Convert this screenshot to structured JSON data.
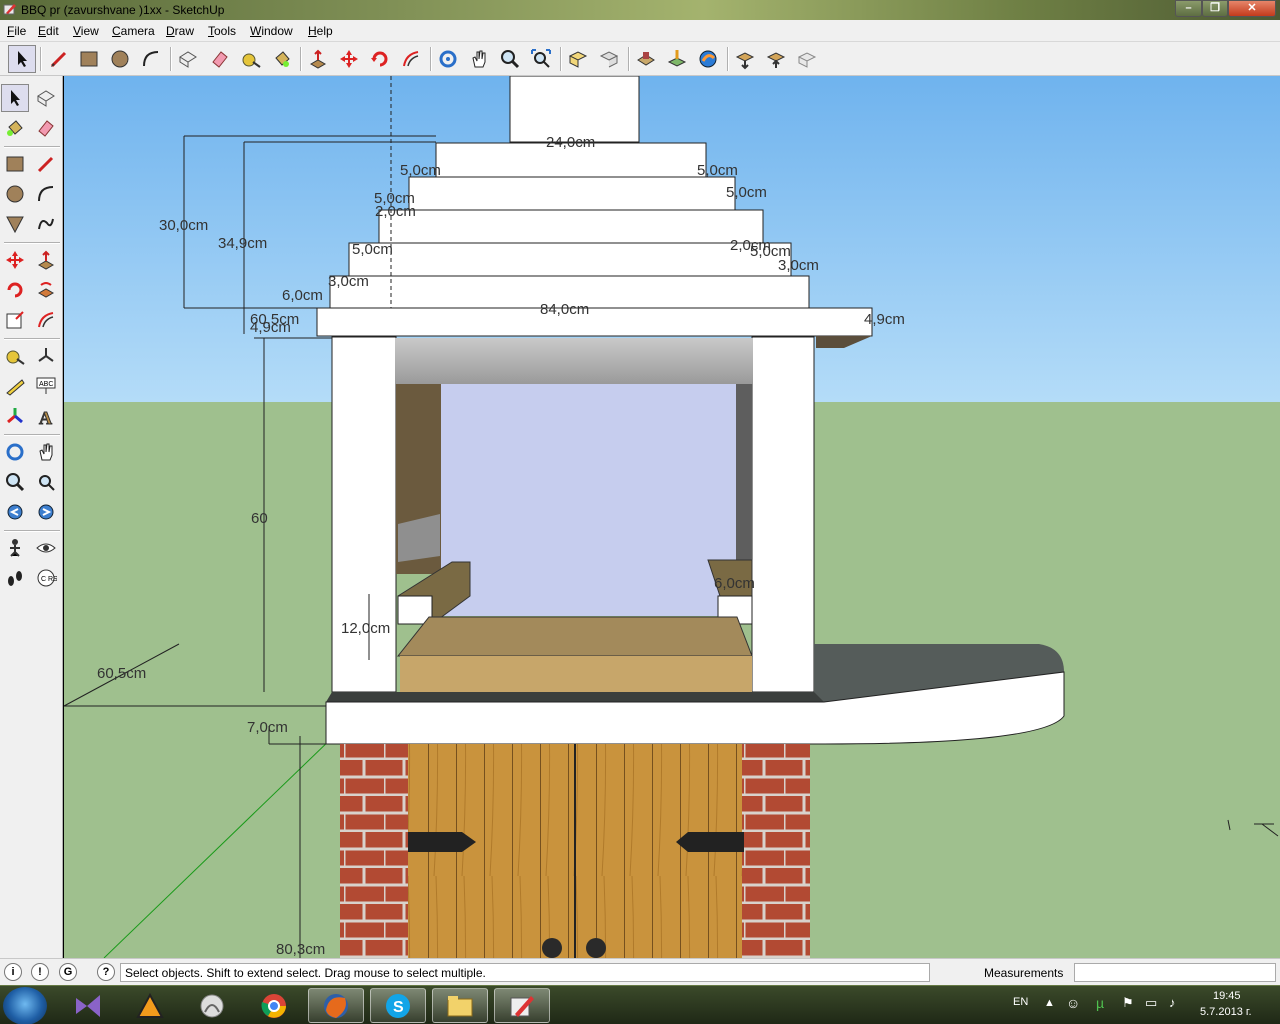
{
  "window": {
    "title": "BBQ pr (zavurshvane )1xx - SketchUp"
  },
  "menu": [
    "File",
    "Edit",
    "View",
    "Camera",
    "Draw",
    "Tools",
    "Window",
    "Help"
  ],
  "dimensions": {
    "top_width": "24,0cm",
    "step_top_left": "5,0cm",
    "step_top_right": "5,0cm",
    "step2_left": "5,0cm",
    "step2_right": "5,0cm",
    "step2_left_b": "2,0cm",
    "step3_right": "2,0cm",
    "step3_right_b": "5,0cm",
    "step3_right_c": "3,0cm",
    "step4_left": "5,0cm",
    "step5_left": "3,0cm",
    "rise_6": "6,0cm",
    "slab_60": "60,5cm",
    "slab_4_9_left": "4,9cm",
    "overhang_4_9": "4,9cm",
    "cap_width": "84,0cm",
    "height_30": "30,0cm",
    "height_34_9": "34,9cm",
    "height_60": "60",
    "firebox_12": "12,0cm",
    "ledge_6": "6,0cm",
    "depth_60_5": "60,5cm",
    "counter_7": "7,0cm",
    "base_80_3": "80,3cm"
  },
  "status": {
    "message": "Select objects. Shift to extend select. Drag mouse to select multiple.",
    "measurements_label": "Measurements",
    "measurements_value": ""
  },
  "taskbar": {
    "lang": "EN",
    "time": "19:45",
    "date": "5.7.2013 г."
  },
  "colors": {
    "sky": "#88c8f5",
    "ground": "#9fc08e",
    "brick": "#b24a33",
    "wood": "#c9933d"
  }
}
